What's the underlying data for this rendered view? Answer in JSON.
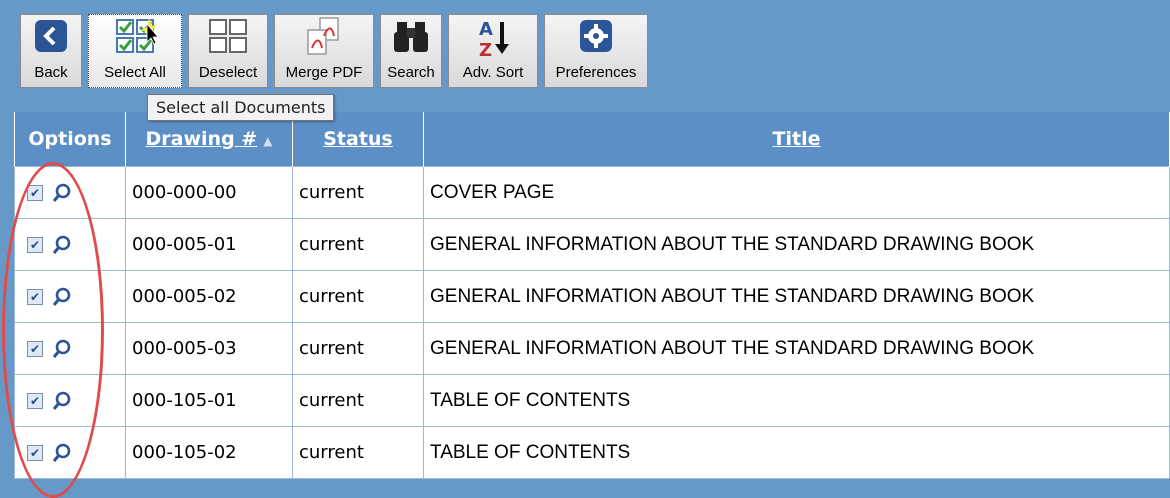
{
  "toolbar": {
    "back_label": "Back",
    "select_all_label": "Select All",
    "deselect_label": "Deselect",
    "merge_pdf_label": "Merge PDF",
    "search_label": "Search",
    "adv_sort_label": "Adv. Sort",
    "preferences_label": "Preferences"
  },
  "tooltip": "Select all Documents",
  "table": {
    "headers": {
      "options": "Options",
      "drawing": "Drawing #",
      "status": "Status",
      "title": "Title"
    },
    "rows": [
      {
        "drawing": "000-000-00",
        "status": "current",
        "title": "COVER PAGE"
      },
      {
        "drawing": "000-005-01",
        "status": "current",
        "title": "GENERAL INFORMATION ABOUT THE STANDARD DRAWING BOOK"
      },
      {
        "drawing": "000-005-02",
        "status": "current",
        "title": "GENERAL INFORMATION ABOUT THE STANDARD DRAWING BOOK"
      },
      {
        "drawing": "000-005-03",
        "status": "current",
        "title": "GENERAL INFORMATION ABOUT THE STANDARD DRAWING BOOK"
      },
      {
        "drawing": "000-105-01",
        "status": "current",
        "title": "TABLE OF CONTENTS"
      },
      {
        "drawing": "000-105-02",
        "status": "current",
        "title": "TABLE OF CONTENTS"
      }
    ]
  },
  "colors": {
    "background": "#6699c8",
    "header": "#5b8fc6",
    "highlight_ellipse": "#e04b4b"
  }
}
